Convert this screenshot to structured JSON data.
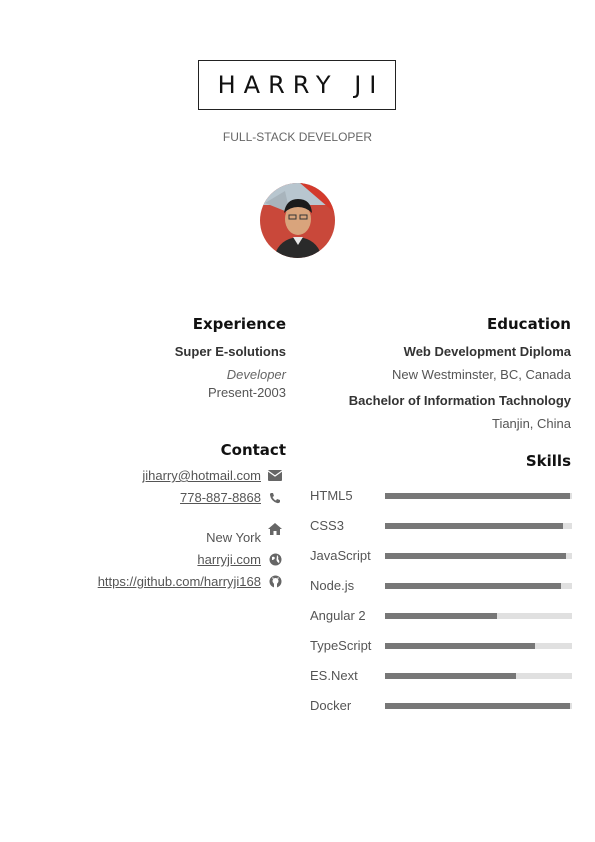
{
  "header": {
    "name": "HARRY JI",
    "title": "FULL-STACK DEVELOPER"
  },
  "experience": {
    "heading": "Experience",
    "company": "Super E-solutions",
    "role": "Developer",
    "period": "Present-2003"
  },
  "contact": {
    "heading": "Contact",
    "email": "jiharry@hotmail.com",
    "phone": "778-887-8868",
    "location": "New York",
    "website": "harryji.com",
    "github": "https://github.com/harryji168"
  },
  "education": {
    "heading": "Education",
    "items": [
      {
        "degree": "Web Development Diploma",
        "place": "New Westminster, BC, Canada"
      },
      {
        "degree": "Bachelor of Information Tachnology",
        "place": "Tianjin, China"
      }
    ]
  },
  "skills": {
    "heading": "Skills",
    "items": [
      {
        "name": "HTML5",
        "level": 0.99
      },
      {
        "name": "CSS3",
        "level": 0.95
      },
      {
        "name": "JavaScript",
        "level": 0.97
      },
      {
        "name": "Node.js",
        "level": 0.94
      },
      {
        "name": "Angular 2",
        "level": 0.6
      },
      {
        "name": "TypeScript",
        "level": 0.8
      },
      {
        "name": "ES.Next",
        "level": 0.7
      },
      {
        "name": "Docker",
        "level": 0.99
      }
    ]
  },
  "colors": {
    "bar_fill": "#777777",
    "bar_track": "#e0e0e0"
  }
}
